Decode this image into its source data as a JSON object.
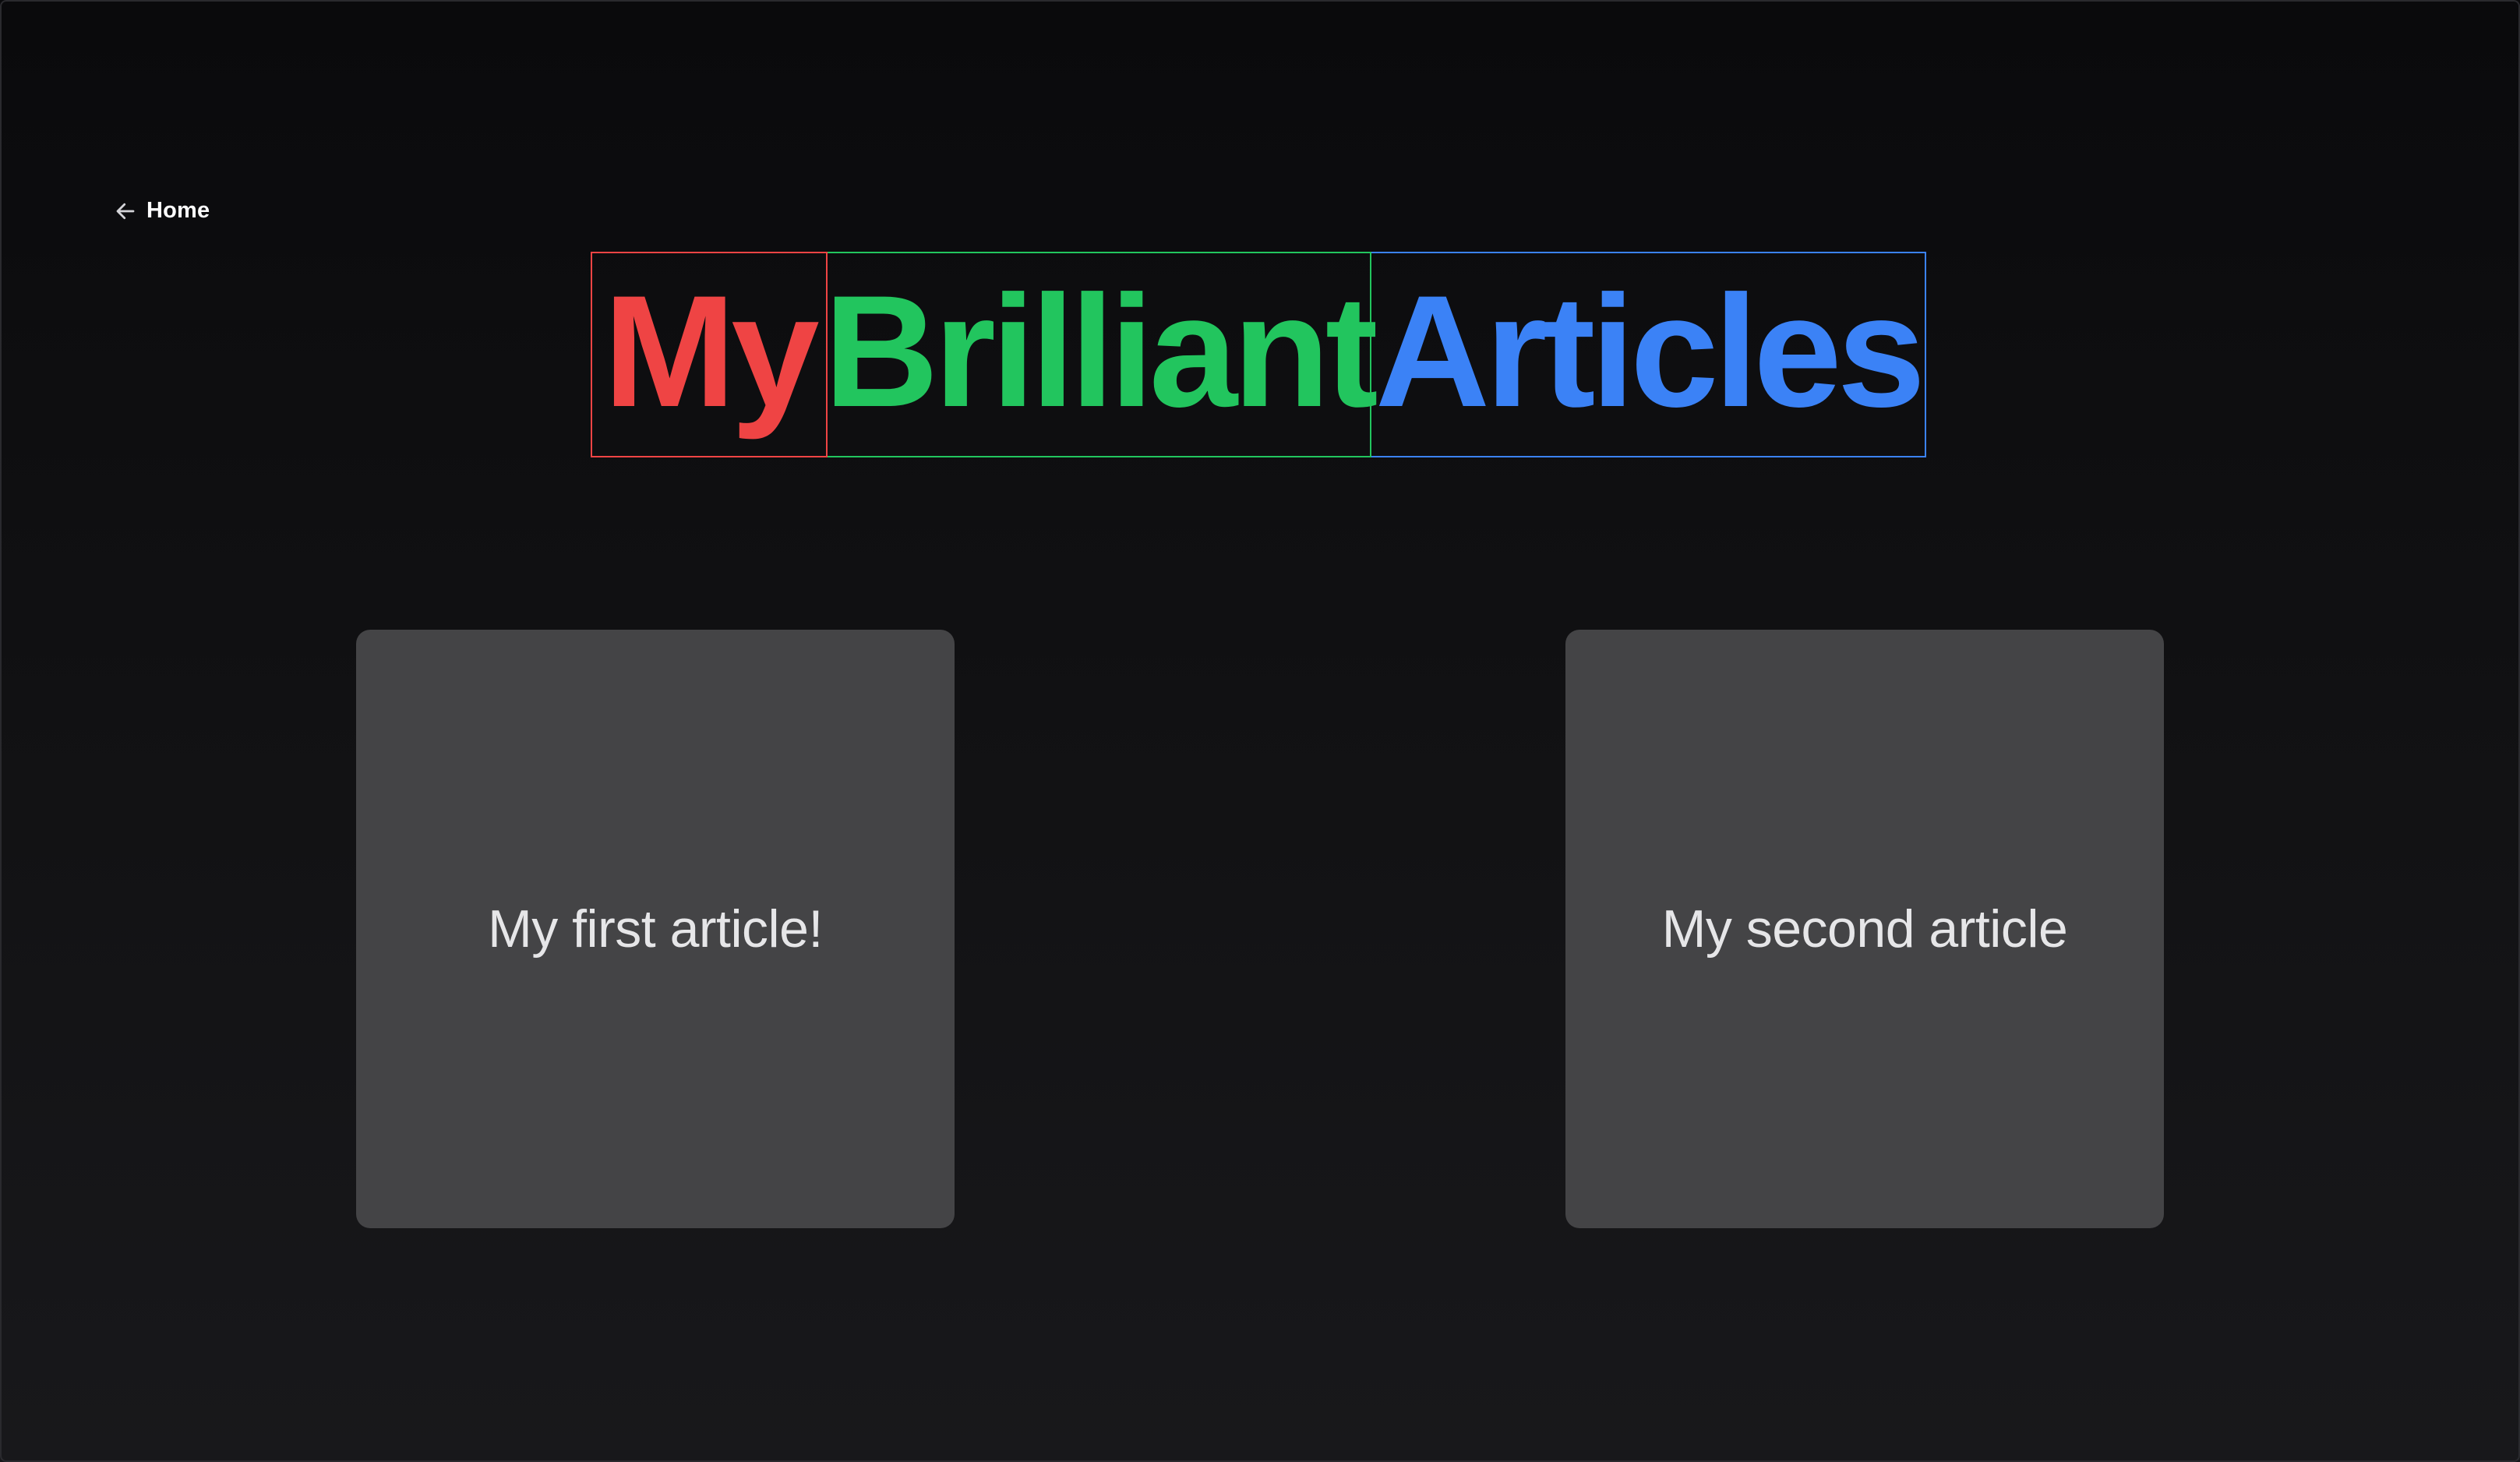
{
  "nav": {
    "back_icon": "arrow-left-icon",
    "back_label": "Home"
  },
  "heading": {
    "words": [
      {
        "text": "My",
        "color": "#ef4444"
      },
      {
        "text": "Brilliant",
        "color": "#22c55e"
      },
      {
        "text": "Articles",
        "color": "#3b82f6"
      }
    ]
  },
  "articles": [
    {
      "title": "My first article!"
    },
    {
      "title": "My second article"
    }
  ],
  "colors": {
    "background": "#0e0e10",
    "card": "#444446",
    "card_text": "#e6e6e8"
  }
}
